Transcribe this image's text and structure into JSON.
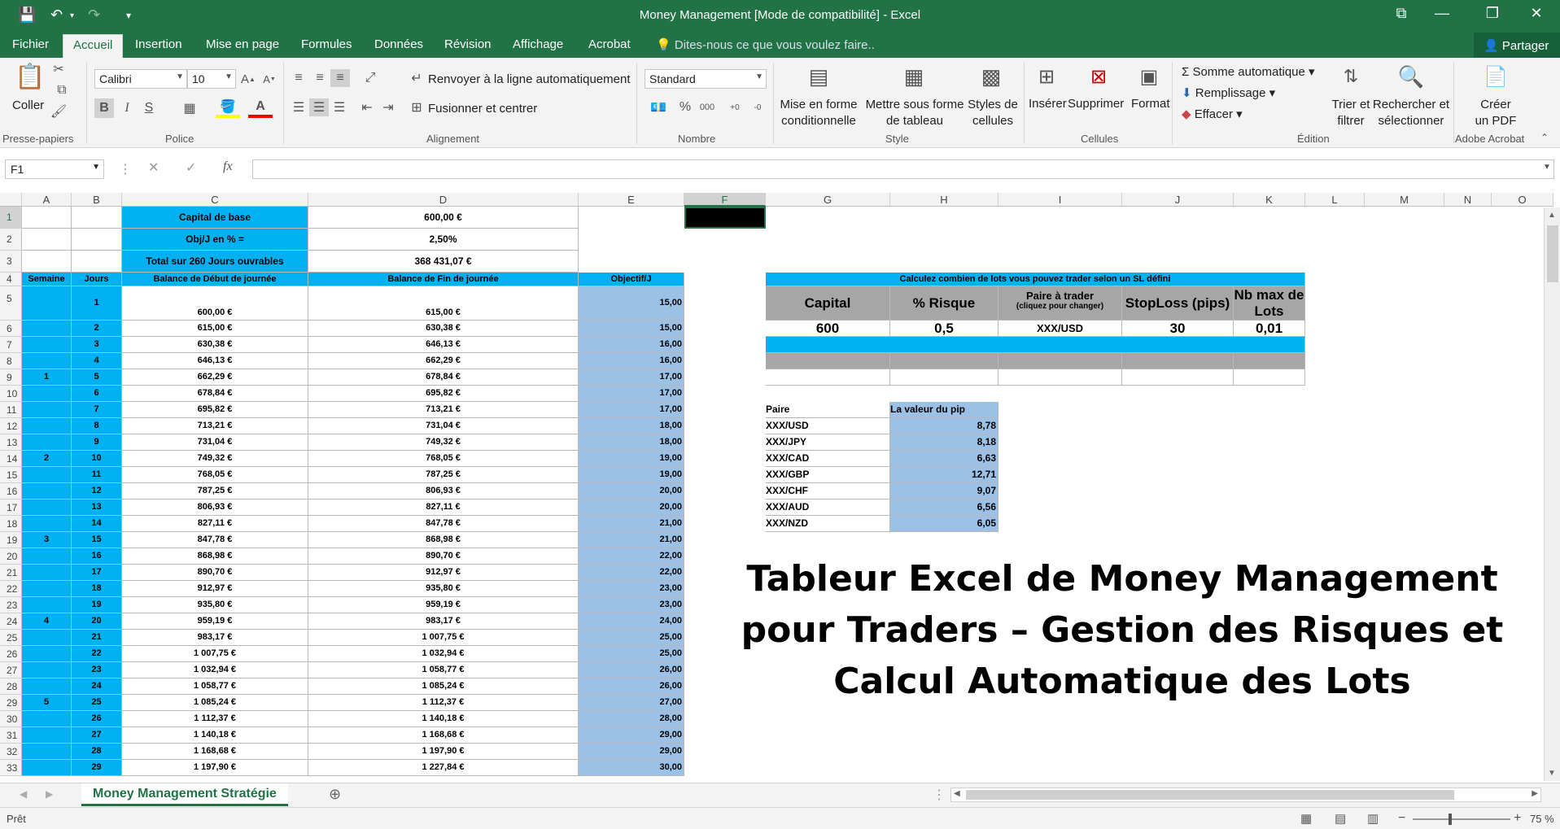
{
  "window": {
    "title": "Money Management  [Mode de compatibilité] - Excel"
  },
  "menu": {
    "tabs": [
      "Fichier",
      "Accueil",
      "Insertion",
      "Mise en page",
      "Formules",
      "Données",
      "Révision",
      "Affichage",
      "Acrobat"
    ],
    "active": "Accueil",
    "tellme": "Dites-nous ce que vous voulez faire..",
    "share": "Partager"
  },
  "ribbon": {
    "paste": "Coller",
    "clipboard": "Presse-papiers",
    "font_name": "Calibri",
    "font_size": "10",
    "font_group": "Police",
    "wrap": "Renvoyer à la ligne automatiquement",
    "merge": "Fusionner et centrer",
    "align_group": "Alignement",
    "number_format": "Standard",
    "number_group": "Nombre",
    "cond_format": [
      "Mise en forme",
      "conditionnelle"
    ],
    "table_format": [
      "Mettre sous forme",
      "de tableau"
    ],
    "cell_styles": [
      "Styles de",
      "cellules"
    ],
    "style_group": "Style",
    "insert": "Insérer",
    "delete": "Supprimer",
    "format": "Format",
    "cells_group": "Cellules",
    "autosum": "Somme automatique",
    "fill": "Remplissage",
    "clear": "Effacer",
    "sort": [
      "Trier et",
      "filtrer"
    ],
    "find": [
      "Rechercher et",
      "sélectionner"
    ],
    "edit_group": "Édition",
    "pdf": [
      "Créer",
      "un PDF"
    ],
    "acrobat_group": "Adobe Acrobat"
  },
  "formula": {
    "cell": "F1",
    "value": ""
  },
  "columns": [
    "A",
    "B",
    "C",
    "D",
    "E",
    "F",
    "G",
    "H",
    "I",
    "J",
    "K",
    "L",
    "M",
    "N",
    "O"
  ],
  "rows_visible": 33,
  "summary": {
    "capital_label": "Capital de base",
    "capital_value": "600,00 €",
    "obj_label": "Obj/J en % =",
    "obj_value": "2,50%",
    "total_label": "Total sur 260 Jours ouvrables",
    "total_value": "368 431,07 €"
  },
  "table_headers": [
    "Semaine",
    "Jours",
    "Balance de Début de journée",
    "Balance de Fin de journée",
    "Objectif/J"
  ],
  "weeks": [
    {
      "row": 9,
      "label": "1"
    },
    {
      "row": 14,
      "label": "2"
    },
    {
      "row": 19,
      "label": "3"
    },
    {
      "row": 24,
      "label": "4"
    },
    {
      "row": 29,
      "label": "5"
    }
  ],
  "days": [
    [
      "1",
      "600,00 €",
      "615,00 €",
      "15,00"
    ],
    [
      "2",
      "615,00 €",
      "630,38 €",
      "15,00"
    ],
    [
      "3",
      "630,38 €",
      "646,13 €",
      "16,00"
    ],
    [
      "4",
      "646,13 €",
      "662,29 €",
      "16,00"
    ],
    [
      "5",
      "662,29 €",
      "678,84 €",
      "17,00"
    ],
    [
      "6",
      "678,84 €",
      "695,82 €",
      "17,00"
    ],
    [
      "7",
      "695,82 €",
      "713,21 €",
      "17,00"
    ],
    [
      "8",
      "713,21 €",
      "731,04 €",
      "18,00"
    ],
    [
      "9",
      "731,04 €",
      "749,32 €",
      "18,00"
    ],
    [
      "10",
      "749,32 €",
      "768,05 €",
      "19,00"
    ],
    [
      "11",
      "768,05 €",
      "787,25 €",
      "19,00"
    ],
    [
      "12",
      "787,25 €",
      "806,93 €",
      "20,00"
    ],
    [
      "13",
      "806,93 €",
      "827,11 €",
      "20,00"
    ],
    [
      "14",
      "827,11 €",
      "847,78 €",
      "21,00"
    ],
    [
      "15",
      "847,78 €",
      "868,98 €",
      "21,00"
    ],
    [
      "16",
      "868,98 €",
      "890,70 €",
      "22,00"
    ],
    [
      "17",
      "890,70 €",
      "912,97 €",
      "22,00"
    ],
    [
      "18",
      "912,97 €",
      "935,80 €",
      "23,00"
    ],
    [
      "19",
      "935,80 €",
      "959,19 €",
      "23,00"
    ],
    [
      "20",
      "959,19 €",
      "983,17 €",
      "24,00"
    ],
    [
      "21",
      "983,17 €",
      "1 007,75 €",
      "25,00"
    ],
    [
      "22",
      "1 007,75 €",
      "1 032,94 €",
      "25,00"
    ],
    [
      "23",
      "1 032,94 €",
      "1 058,77 €",
      "26,00"
    ],
    [
      "24",
      "1 058,77 €",
      "1 085,24 €",
      "26,00"
    ],
    [
      "25",
      "1 085,24 €",
      "1 112,37 €",
      "27,00"
    ],
    [
      "26",
      "1 112,37 €",
      "1 140,18 €",
      "28,00"
    ],
    [
      "27",
      "1 140,18 €",
      "1 168,68 €",
      "29,00"
    ],
    [
      "28",
      "1 168,68 €",
      "1 197,90 €",
      "29,00"
    ],
    [
      "29",
      "1 197,90 €",
      "1 227,84 €",
      "30,00"
    ]
  ],
  "calculator": {
    "title": "Calculez combien de lots vous pouvez trader selon un SL défini",
    "headers": [
      "Capital",
      "% Risque",
      "Paire à trader",
      "StopLoss (pips)",
      "Nb max de Lots"
    ],
    "pair_hint": "(cliquez pour changer)",
    "values": [
      "600",
      "0,5",
      "XXX/USD",
      "30",
      "0,01"
    ]
  },
  "pip_table": {
    "headers": [
      "Paire",
      "La valeur du pip"
    ],
    "rows": [
      [
        "XXX/USD",
        "8,78"
      ],
      [
        "XXX/JPY",
        "8,18"
      ],
      [
        "XXX/CAD",
        "6,63"
      ],
      [
        "XXX/GBP",
        "12,71"
      ],
      [
        "XXX/CHF",
        "9,07"
      ],
      [
        "XXX/AUD",
        "6,56"
      ],
      [
        "XXX/NZD",
        "6,05"
      ]
    ]
  },
  "banner": {
    "text": "Tableur Excel de Money Management pour Traders – Gestion des Risques et Calcul Automatique des Lots"
  },
  "sheet_tab": "Money Management Stratégie",
  "status": {
    "ready": "Prêt",
    "zoom": "75 %"
  },
  "colors": {
    "excel_green": "#217346",
    "cyan": "#00b0f0",
    "light_blue": "#9bc2e6",
    "gray": "#a6a6a6"
  }
}
